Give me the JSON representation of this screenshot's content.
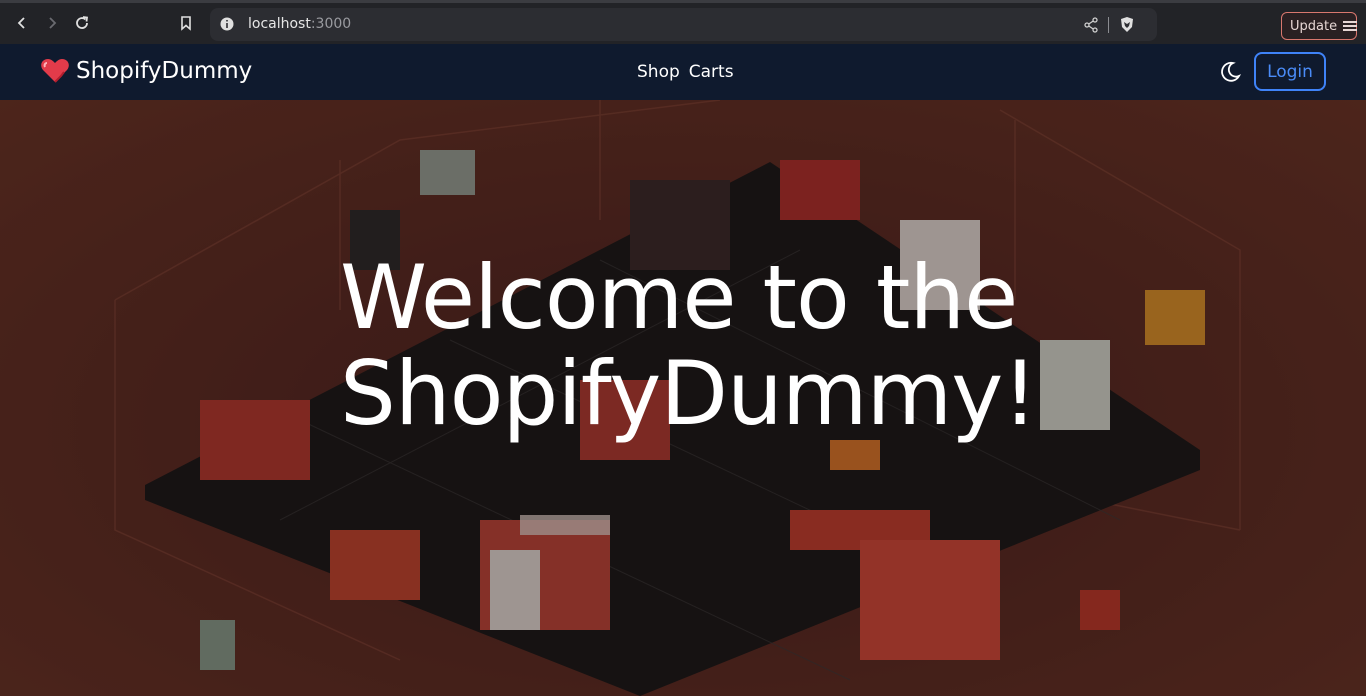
{
  "browser": {
    "url_host": "localhost",
    "url_port": ":3000",
    "update_label": "Update"
  },
  "navbar": {
    "brand": "ShopifyDummy",
    "links": [
      "Shop",
      "Carts"
    ],
    "login_label": "Login"
  },
  "hero": {
    "title_line1": "Welcome to the",
    "title_line2": "ShopifyDummy!"
  },
  "colors": {
    "navbar_bg": "#0f1a2e",
    "login_accent": "#3f83f8",
    "hero_bg": "#5a2a22",
    "update_border": "#d9776e"
  }
}
